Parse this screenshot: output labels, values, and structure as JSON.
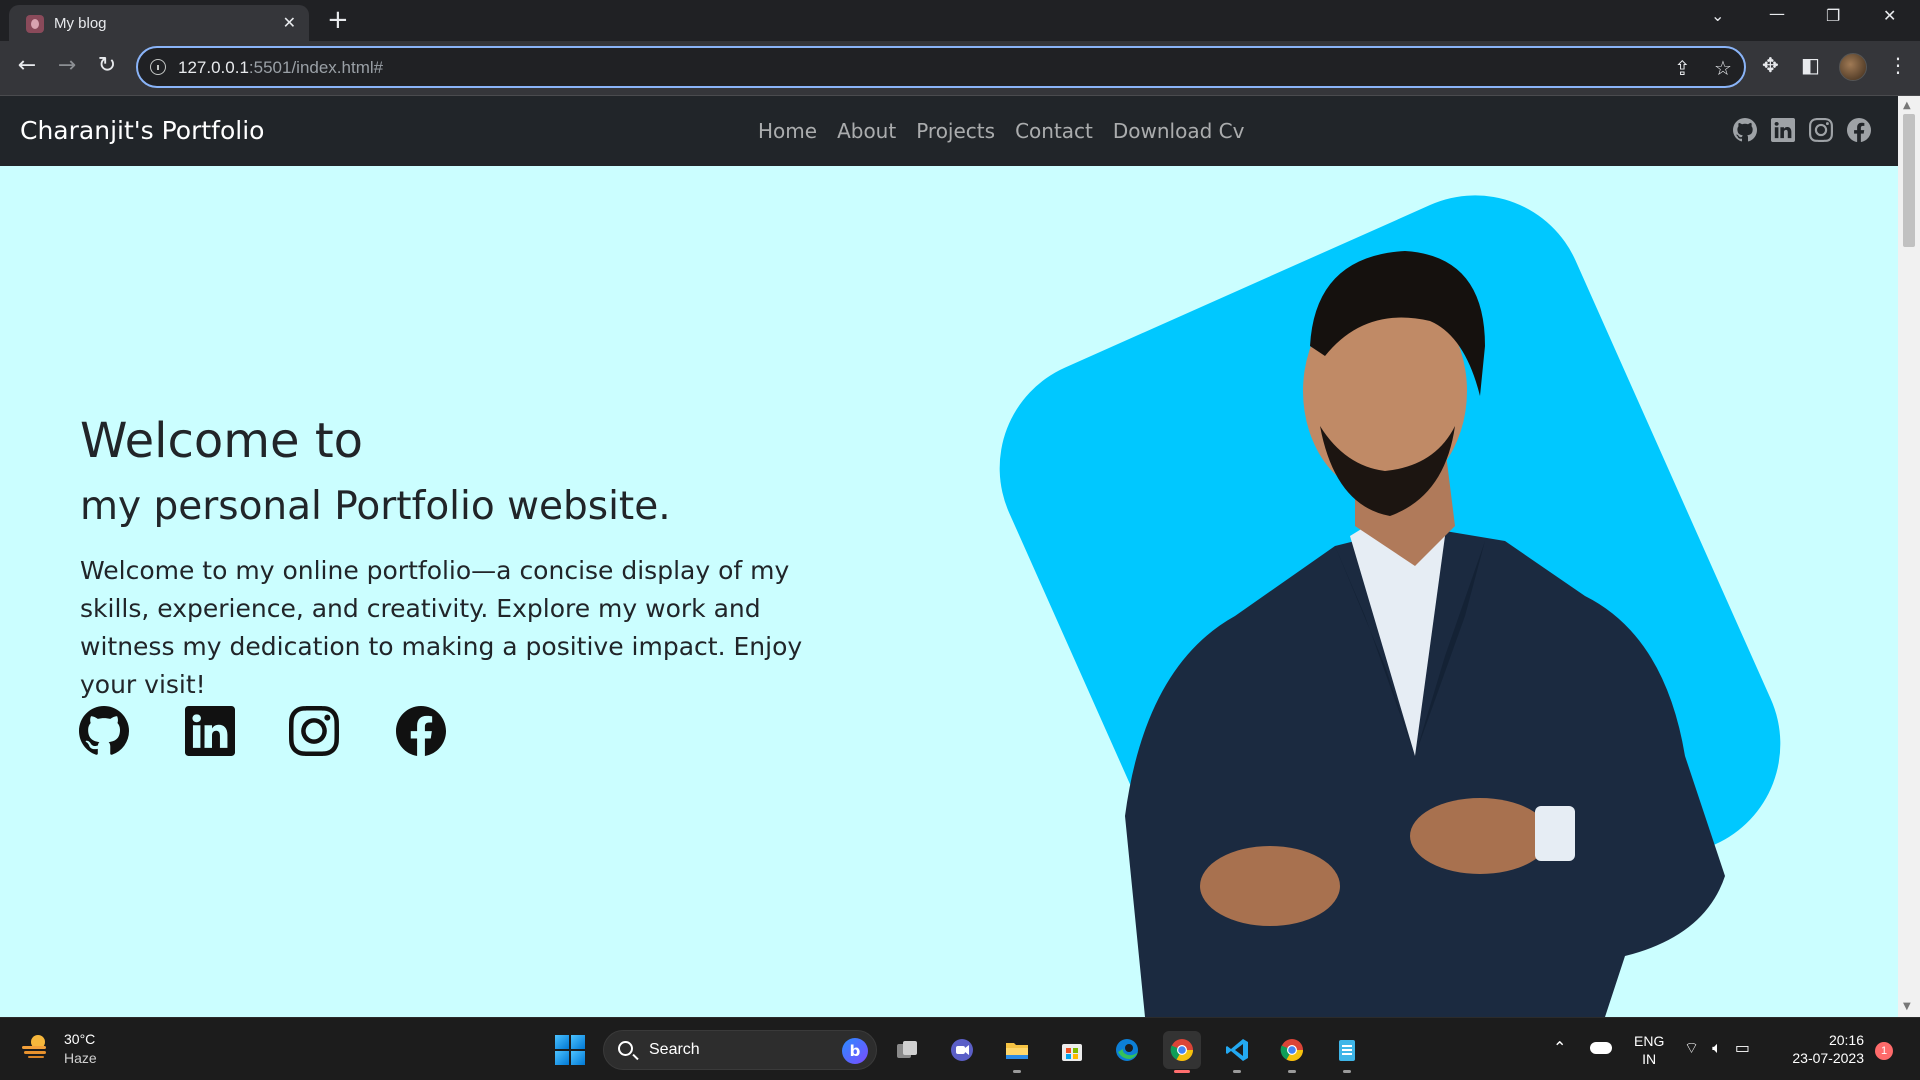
{
  "browser": {
    "tab_title": "My blog",
    "tab_close": "✕",
    "new_tab": "+",
    "url_host": "127.0.0.1",
    "url_rest": ":5501/index.html#"
  },
  "site": {
    "brand": "Charanjit's Portfolio",
    "nav": [
      "Home",
      "About",
      "Projects",
      "Contact",
      "Download Cv"
    ],
    "nav_social_icons": [
      "github-icon",
      "linkedin-icon",
      "instagram-icon",
      "facebook-icon"
    ],
    "hero": {
      "heading": "Welcome to",
      "subheading": "my personal Portfolio website.",
      "body": "Welcome to my online portfolio—a concise display of my skills, experience, and creativity. Explore my work and witness my dedication to making a positive impact. Enjoy your visit!",
      "social_icons": [
        "github-icon",
        "linkedin-icon",
        "instagram-icon",
        "facebook-icon"
      ]
    },
    "colors": {
      "hero_bg": "#cbfeff",
      "navbar_bg": "#212529",
      "accent_blob": "#00c8ff"
    }
  },
  "taskbar": {
    "weather_temp": "30°C",
    "weather_cond": "Haze",
    "search_label": "Search",
    "lang_top": "ENG",
    "lang_bottom": "IN",
    "time": "20:16",
    "date": "23-07-2023",
    "notification_count": "1",
    "pinned_apps": [
      "start",
      "search",
      "task-view",
      "teams",
      "file-explorer",
      "store",
      "edge",
      "chrome",
      "vscode",
      "chrome",
      "notepad"
    ]
  }
}
